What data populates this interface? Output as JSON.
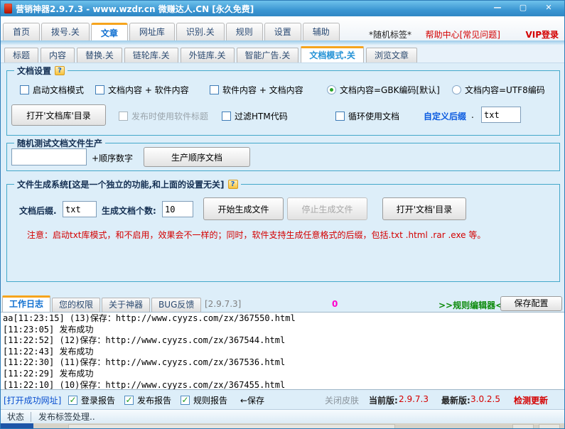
{
  "icons": {
    "help": "?",
    "check": "✓",
    "minimize": "—",
    "maximize": "▢",
    "close": "✕"
  },
  "colors": {
    "accent_orange": "#f6a41c",
    "title_blue": "#3b96d2",
    "alert_red": "#d40000",
    "link_green": "#0b8a0b",
    "counter_magenta": "#ff00cc",
    "link_blue": "#0a50d0"
  },
  "title_bar": {
    "title": "营销神器2.9.7.3 - www.wzdr.cn 微赚达人.CN [永久免费]"
  },
  "main_tabs": {
    "items": [
      {
        "label": "首页",
        "active": false
      },
      {
        "label": "拨号.关",
        "active": false
      },
      {
        "label": "文章",
        "active": true
      },
      {
        "label": "网址库",
        "active": false
      },
      {
        "label": "识别.关",
        "active": false
      },
      {
        "label": "规则",
        "active": false
      },
      {
        "label": "设置",
        "active": false
      },
      {
        "label": "辅助",
        "active": false
      }
    ],
    "random_tag": "*随机标签*",
    "help_center": "帮助中心[常见问题]",
    "vip_login": "VIP登录"
  },
  "sub_tabs": {
    "items": [
      {
        "label": "标题",
        "active": false
      },
      {
        "label": "内容",
        "active": false
      },
      {
        "label": "替换.关",
        "active": false
      },
      {
        "label": "链轮库.关",
        "active": false
      },
      {
        "label": "外链库.关",
        "active": false
      },
      {
        "label": "智能广告.关",
        "active": false
      },
      {
        "label": "文档模式.关",
        "active": true
      },
      {
        "label": "浏览文章",
        "active": false
      }
    ]
  },
  "doc_settings": {
    "legend": "文档设置",
    "checkbox_start_doc_mode": "启动文档模式",
    "checkbox_doc_plus_soft": "文档内容 + 软件内容",
    "checkbox_soft_plus_doc": "软件内容 + 文档内容",
    "radio_gbk": "文档内容=GBK编码[默认]",
    "radio_utf8": "文档内容=UTF8编码",
    "open_doclib_button": "打开'文档库'目录",
    "checkbox_soft_title": "发布时使用软件标题",
    "checkbox_filter_htm": "过滤HTM代码",
    "checkbox_loop_doc": "循环使用文档",
    "custom_suffix_label": "自定义后缀",
    "custom_suffix_dot": ".",
    "suffix_value": "txt"
  },
  "random_test": {
    "legend": "随机测试文档文件生产",
    "input_value": "",
    "plus_label": "+顺序数字",
    "generate_button": "生产顺序文档"
  },
  "file_gen": {
    "legend": "文件生成系统[这是一个独立的功能,和上面的设置无关]",
    "suffix_label": "文档后缀.",
    "suffix_value": "txt",
    "count_label": "生成文档个数:",
    "count_value": "10",
    "start_button": "开始生成文件",
    "stop_button": "停止生成文件",
    "open_dir_button": "打开'文档'目录",
    "note": "注意：启动txt库模式，和不启用，效果会不一样的；同时，软件支持生成任意格式的后缀，包括.txt .html .rar .exe 等。"
  },
  "bottom_tabs": {
    "items": [
      {
        "label": "工作日志",
        "active": true
      },
      {
        "label": "您的权限",
        "active": false
      },
      {
        "label": "关于神器",
        "active": false
      },
      {
        "label": "BUG反馈",
        "active": false
      }
    ],
    "version": "[2.9.7.3]",
    "counter": "0",
    "rule_editor": ">>规则编辑器<<",
    "save_config_button": "保存配置"
  },
  "log": {
    "lines": [
      "aa[11:23:15] (13)保存：http://www.cyyzs.com/zx/367550.html",
      "[11:23:05] 发布成功",
      "[11:22:52] (12)保存：http://www.cyyzs.com/zx/367544.html",
      "[11:22:43] 发布成功",
      "[11:22:30] (11)保存：http://www.cyyzs.com/zx/367536.html",
      "[11:22:29] 发布成功",
      "[11:22:10] (10)保存：http://www.cyyzs.com/zx/367455.html"
    ]
  },
  "footer": {
    "open_success_link": "[打开成功网址]",
    "login_report": "登录报告",
    "publish_report": "发布报告",
    "rule_report": "规则报告",
    "save_arrow": "←保存",
    "close_skin": "关闭皮肤",
    "current_label": "当前版:",
    "current_version": "2.9.7.3",
    "latest_label": "最新版:",
    "latest_version": "3.0.2.5",
    "check_update": "检测更新"
  },
  "status_bar": {
    "label": "状态",
    "message": "发布标签处理.."
  }
}
